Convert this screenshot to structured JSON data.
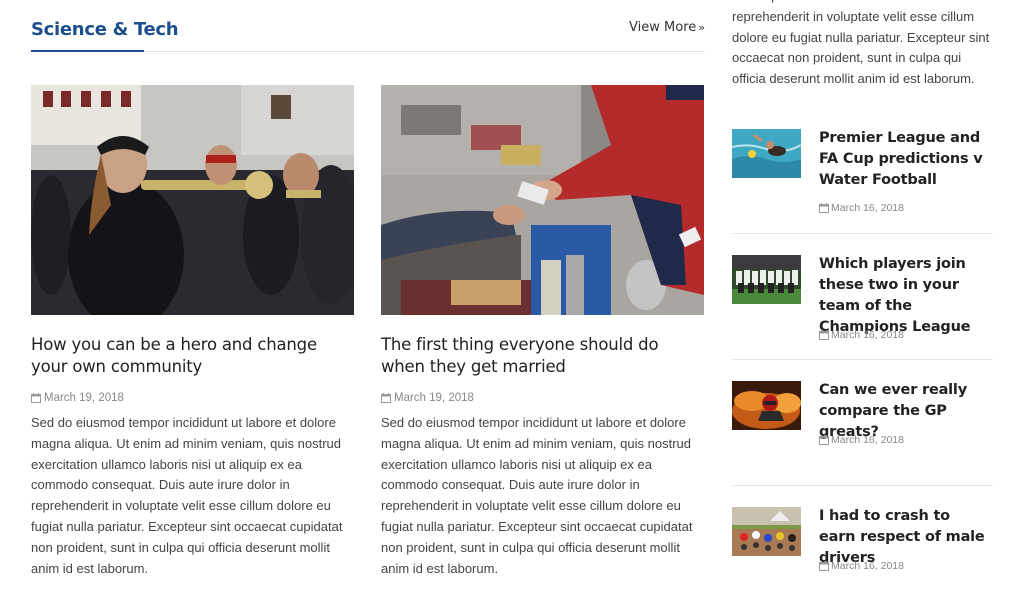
{
  "section": {
    "title": "Science & Tech",
    "view_more": "View More",
    "accent_color": "#1f4e8c"
  },
  "cards": [
    {
      "image": "brass-band-trumpet-photo",
      "title": "How you can be a hero and change your own community",
      "date": "March 19, 2018",
      "excerpt": "Sed do eiusmod tempor incididunt ut labore et dolore magna aliqua. Ut enim ad minim veniam, quis nostrud exercitation ullamco laboris nisi ut aliquip ex ea commodo consequat. Duis aute irure dolor in reprehenderit in voluptate velit esse cillum dolore eu fugiat nulla pariatur. Excepteur sint occaecat cupidatat non proident, sunt in culpa qui officia deserunt mollit anim id est laborum."
    },
    {
      "image": "market-cash-exchange-photo",
      "title": "The first thing everyone should do when they get married",
      "date": "March 19, 2018",
      "excerpt": "Sed do eiusmod tempor incididunt ut labore et dolore magna aliqua. Ut enim ad minim veniam, quis nostrud exercitation ullamco laboris nisi ut aliquip ex ea commodo consequat. Duis aute irure dolor in reprehenderit in voluptate velit esse cillum dolore eu fugiat nulla pariatur. Excepteur sint occaecat cupidatat non proident, sunt in culpa qui officia deserunt mollit anim id est laborum."
    }
  ],
  "sidebar": {
    "intro_text": "consequat. Duis aute irure dolor in reprehenderit in voluptate velit esse cillum dolore eu fugiat nulla pariatur. Excepteur sint occaecat non proident, sunt in culpa qui officia deserunt mollit anim id est laborum.",
    "items": [
      {
        "image": "water-polo-photo",
        "title": "Premier League and FA Cup predictions v Water Football",
        "date": "March 16, 2018"
      },
      {
        "image": "football-team-photo",
        "title": "Which players join these two in your team of the Champions League",
        "date": "March 16, 2018"
      },
      {
        "image": "motorcycle-racer-photo",
        "title": "Can we ever really compare the GP greats?",
        "date": "March 16, 2018"
      },
      {
        "image": "motocross-race-photo",
        "title": "I had to crash to earn respect of male drivers",
        "date": "March 16, 2018"
      }
    ]
  }
}
